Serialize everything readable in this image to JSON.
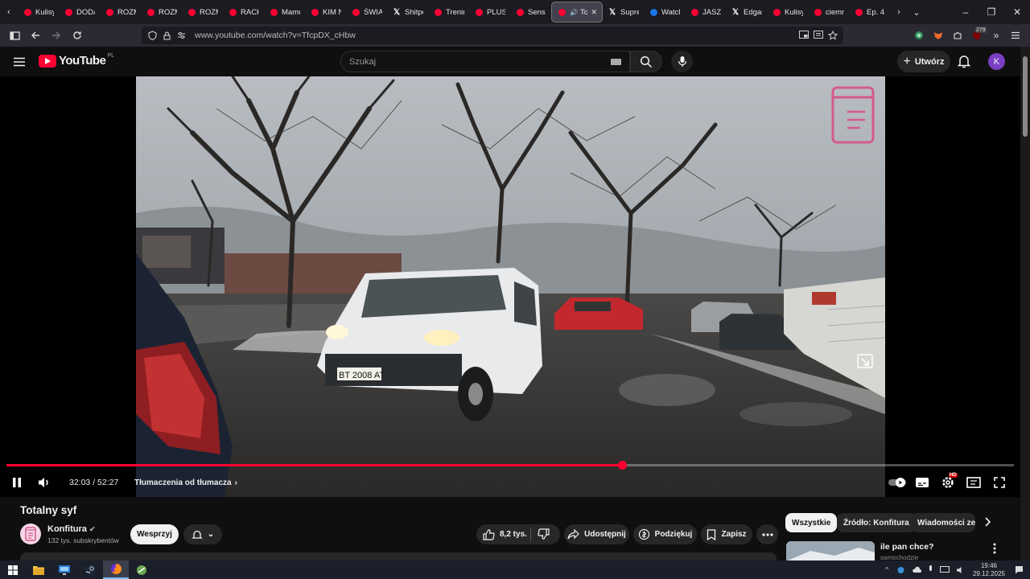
{
  "browser": {
    "tabs": [
      {
        "label": "Kulisy",
        "icon": "youtube-icon"
      },
      {
        "label": "DODA",
        "icon": "youtube-icon"
      },
      {
        "label": "ROZM",
        "icon": "youtube-icon"
      },
      {
        "label": "ROZM",
        "icon": "youtube-icon"
      },
      {
        "label": "ROZM",
        "icon": "youtube-icon"
      },
      {
        "label": "RACH",
        "icon": "youtube-icon"
      },
      {
        "label": "Mamu",
        "icon": "youtube-icon"
      },
      {
        "label": "KIM N",
        "icon": "youtube-icon"
      },
      {
        "label": "ŚWIĄT",
        "icon": "youtube-icon"
      },
      {
        "label": "Shitpo",
        "icon": "x-icon"
      },
      {
        "label": "Trenin",
        "icon": "youtube-icon"
      },
      {
        "label": "PLUSK",
        "icon": "youtube-icon"
      },
      {
        "label": "Sens p",
        "icon": "youtube-icon"
      },
      {
        "label": "Tota",
        "icon": "youtube-icon",
        "active": true
      },
      {
        "label": "Supre",
        "icon": "x-icon"
      },
      {
        "label": "Watch",
        "icon": "globe-icon"
      },
      {
        "label": "JASZC",
        "icon": "youtube-icon"
      },
      {
        "label": "Edgar",
        "icon": "x-icon"
      },
      {
        "label": "Kulisy",
        "icon": "youtube-icon"
      },
      {
        "label": "ciemn",
        "icon": "youtube-icon"
      },
      {
        "label": "Ep. 4",
        "icon": "youtube-icon"
      }
    ],
    "url": "www.youtube.com/watch?v=TfcpDX_cHbw",
    "extensions_badge": "279"
  },
  "youtube": {
    "logo_text": "YouTube",
    "region": "PL",
    "search_placeholder": "Szukaj",
    "create_label": "Utwórz",
    "avatar_letter": "K"
  },
  "player": {
    "current_time": "32:03",
    "duration": "52:27",
    "time_display": "32:03 / 52:27",
    "progress_fraction": 0.611,
    "chapter_label": "Tłumaczenia od tłumacza",
    "settings_badge": "HD"
  },
  "video_info": {
    "title": "Totalny syf",
    "channel_name": "Konfitura",
    "subscribers": "132 tys. subskrybentów",
    "support_label": "Wesprzyj",
    "likes": "8,2 tys.",
    "share_label": "Udostępnij",
    "thanks_label": "Podziękuj",
    "save_label": "Zapisz"
  },
  "sidebar": {
    "chips": [
      "Wszystkie",
      "Źródło: Konfitura",
      "Wiadomości ze ś"
    ],
    "recommendation_title": "ile pan chce?",
    "recommendation_channel": "samochodzie"
  },
  "taskbar": {
    "time": "19:46",
    "date": "29.12.2025"
  },
  "colors": {
    "youtube_red": "#ff0033",
    "background": "#0f0f0f"
  }
}
